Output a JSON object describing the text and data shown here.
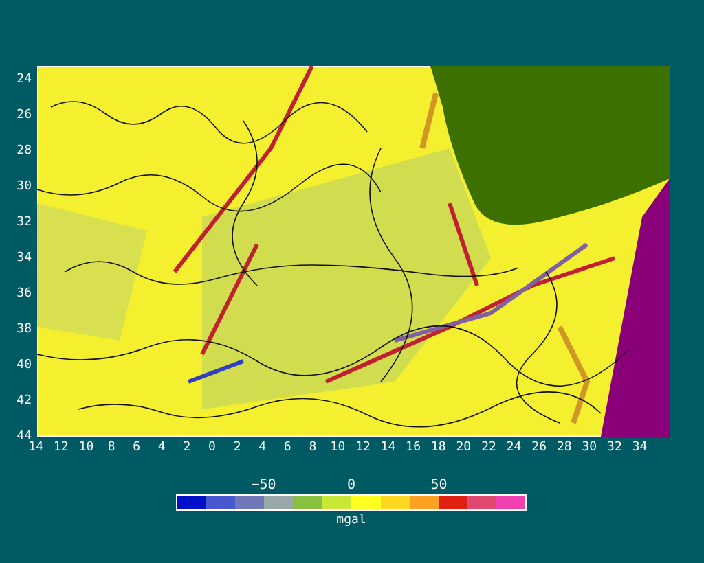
{
  "map": {
    "y_axis_labels": [
      "24",
      "26",
      "28",
      "30",
      "32",
      "34",
      "36",
      "38",
      "40",
      "42",
      "44"
    ],
    "x_axis_labels": [
      "14",
      "12",
      "10",
      "8",
      "6",
      "4",
      "2",
      "0",
      "2",
      "4",
      "6",
      "8",
      "10",
      "12",
      "14",
      "16",
      "18",
      "20",
      "22",
      "24",
      "26",
      "28",
      "30",
      "32",
      "34"
    ]
  },
  "colorbar": {
    "tick_labels": [
      "−50",
      "0",
      "50"
    ],
    "unit": "mgal",
    "segments": [
      {
        "color": "#0010c8"
      },
      {
        "color": "#4858d0"
      },
      {
        "color": "#7078b8"
      },
      {
        "color": "#98a8a8"
      },
      {
        "color": "#88c040"
      },
      {
        "color": "#c8e838"
      },
      {
        "color": "#ffff20"
      },
      {
        "color": "#ffd820"
      },
      {
        "color": "#ffa020"
      },
      {
        "color": "#e02010"
      },
      {
        "color": "#e04870"
      },
      {
        "color": "#f040b0"
      }
    ]
  }
}
